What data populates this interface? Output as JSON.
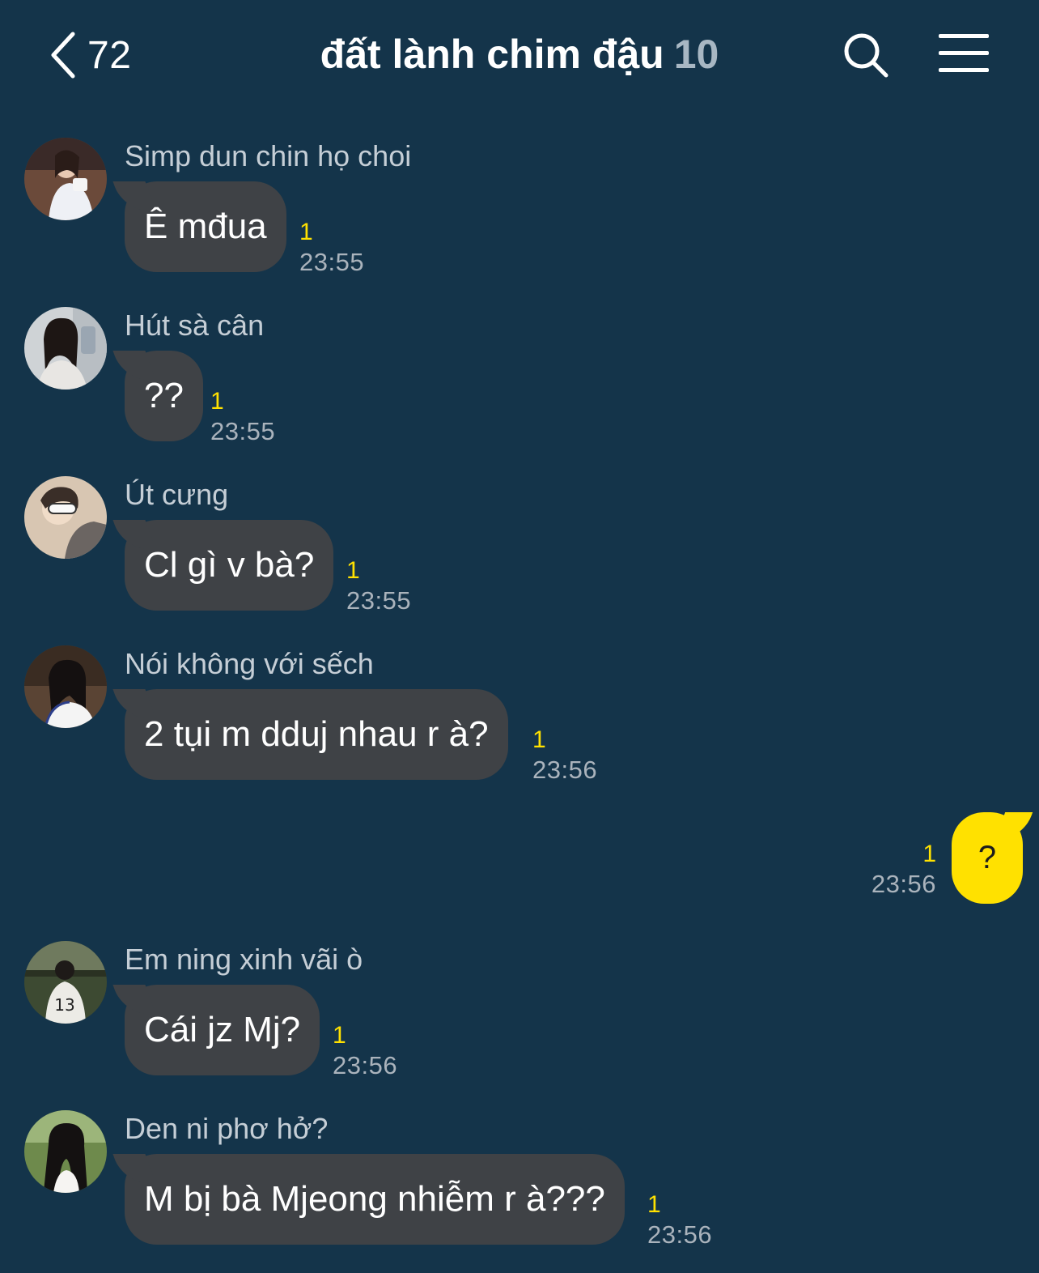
{
  "header": {
    "back_count": "72",
    "title": "đất lành chim đậu",
    "member_count": "10",
    "icons": {
      "back": "chevron-left-icon",
      "search": "search-icon",
      "menu": "menu-icon"
    }
  },
  "colors": {
    "background": "#14344a",
    "incoming_bubble": "#3f4246",
    "outgoing_bubble": "#ffe100",
    "unread": "#ffe100",
    "timestamp": "#aab3bc",
    "sender_name": "#c5ced6"
  },
  "messages": [
    {
      "sender": "Simp dun chin họ choi",
      "text": "Ê mđua",
      "unread": "1",
      "time": "23:55"
    },
    {
      "sender": "Hút sà cân",
      "text": "??",
      "unread": "1",
      "time": "23:55"
    },
    {
      "sender": "Út cưng",
      "text": "Cl gì v bà?",
      "unread": "1",
      "time": "23:55"
    },
    {
      "sender": "Nói không với sếch",
      "text": "2 tụi m dduj nhau r à?",
      "unread": "1",
      "time": "23:56"
    },
    {
      "sender": "Em ning xinh vãi ò",
      "text": "Cái jz Mj?",
      "unread": "1",
      "time": "23:56"
    },
    {
      "sender": "Den ni phơ hở?",
      "text": "M bị bà Mjeong nhiễm r à???",
      "unread": "1",
      "time": "23:56"
    }
  ],
  "own_message": {
    "text": "?",
    "unread": "1",
    "time": "23:56"
  }
}
